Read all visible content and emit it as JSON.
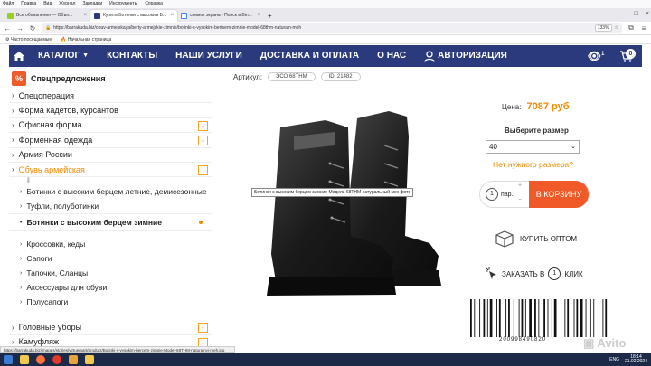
{
  "browser": {
    "menu": [
      "Файл",
      "Правка",
      "Вид",
      "Журнал",
      "Закладки",
      "Инструменты",
      "Справка"
    ],
    "tabs": [
      {
        "title": "Все объявления — Объя...",
        "active": false
      },
      {
        "title": "Купить Ботинки с высоким Б...",
        "active": true
      },
      {
        "title": "снимок экрана - Поиск в Bin...",
        "active": false
      }
    ],
    "url": "https://barrakuda.biz/obuv-armejskaya/berty-armejskie-zimnie/botinki-s-vysokim-bertsem-zimnie-model-68thm-naturaln-meh",
    "zoom": "133%",
    "bookmarks": [
      "Часто посещаемые",
      "Начальная страница"
    ]
  },
  "site_nav": {
    "items": [
      "КАТАЛОГ",
      "КОНТАКТЫ",
      "НАШИ УСЛУГИ",
      "ДОСТАВКА И ОПЛАТА",
      "О НАС",
      "АВТОРИЗАЦИЯ"
    ],
    "eye_count": "1",
    "cart_count": "0"
  },
  "sidebar": {
    "special": "Спецпредложения",
    "special_icon": "%",
    "categories_top": [
      {
        "label": "Спецоперация",
        "chevron": false
      },
      {
        "label": "Форма кадетов, курсантов",
        "chevron": false
      },
      {
        "label": "Офисная форма",
        "chevron": true
      },
      {
        "label": "Форменная одежда",
        "chevron": true
      },
      {
        "label": "Армия России",
        "chevron": false
      },
      {
        "label": "Обувь армейская",
        "chevron": true,
        "active": true
      }
    ],
    "sub_items_1": [
      "Ботинки с высоким берцем летние, демисезонные",
      "Туфли, полуботинки"
    ],
    "sub_active": "Ботинки с высоким берцем зимние",
    "sub_items_2": [
      "Кроссовки, кеды",
      "Сапоги",
      "Тапочки, Сланцы",
      "Аксессуары для обуви",
      "Полусапоги"
    ],
    "categories_bottom": [
      {
        "label": "Головные уборы",
        "chevron": true
      },
      {
        "label": "Камуфляж",
        "chevron": true
      },
      {
        "label": "Индивидуальный пошив",
        "chevron": true
      }
    ]
  },
  "product": {
    "article_label": "Артикул:",
    "article": "ЭСО 68THM",
    "id": "ID: 21482",
    "tooltip": "Ботинки с высоким берцем зимние Модель 68THM натуральный мех фото",
    "price_label": "Цена:",
    "price": "7087 руб",
    "size_label": "Выберите размер",
    "size_value": "40",
    "no_size": "Нет нужного размера?",
    "qty": "1",
    "qty_unit": "пар.",
    "to_cart": "В КОРЗИНУ",
    "wholesale": "КУПИТЬ ОПТОМ",
    "order_pre": "ЗАКАЗАТЬ В",
    "order_num": "1",
    "order_post": "КЛИК",
    "barcode_number": "200998490820",
    "watermark": "Avito"
  },
  "status_url": "https://barrakuda.biz/images/stories/virtuemart/product/Botinki-s-vysokim-bercem-zimnie-Model-68THM-naturalnyj-meh.jpg",
  "taskbar": {
    "lang": "ENG",
    "time": "18:14",
    "date": "21.02.2024"
  },
  "colors": {
    "nav": "#2b3a7d",
    "accent": "#f08a00",
    "cart_btn": "#f05a28"
  }
}
